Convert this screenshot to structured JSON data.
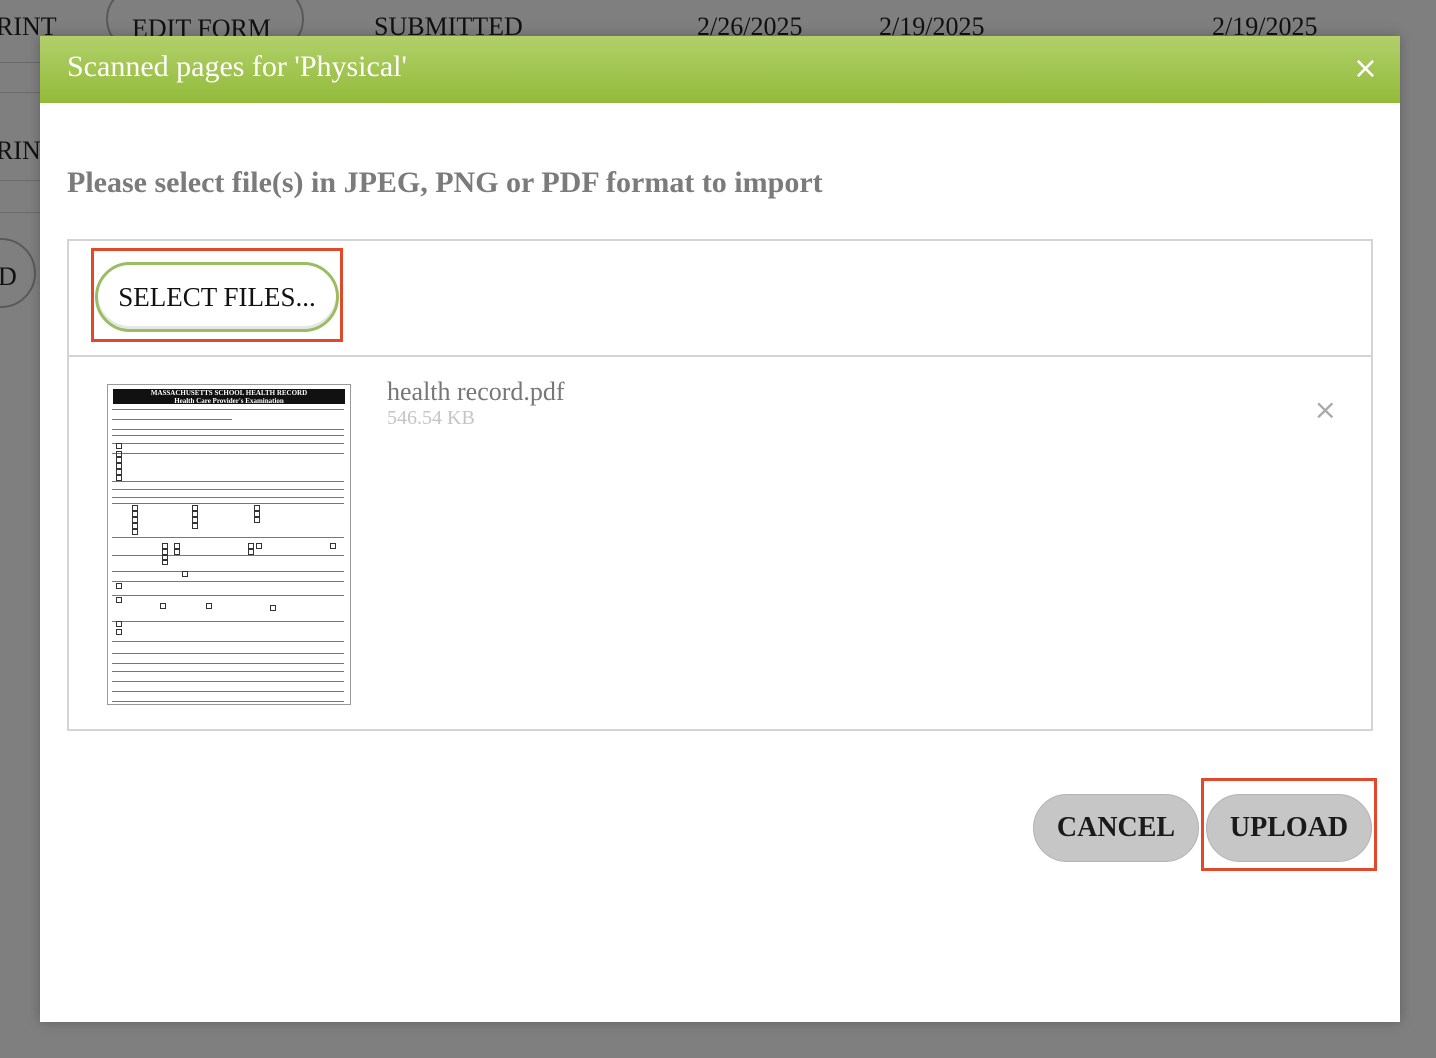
{
  "background": {
    "row1": [
      "RINT",
      "EDIT FORM",
      "SUBMITTED",
      "2/26/2025",
      "2/19/2025",
      "2/19/2025"
    ],
    "row2": [
      "RINT"
    ],
    "row3": [
      "D"
    ]
  },
  "modal": {
    "title": "Scanned pages for 'Physical'",
    "close_icon": "×",
    "instructions": "Please select file(s) in JPEG, PNG or PDF format to import",
    "select_files_label": "SELECT FILES...",
    "file": {
      "name": "health record.pdf",
      "size": "546.54 KB",
      "remove_icon": "×",
      "thumbnail": {
        "title": "MASSACHUSETTS SCHOOL HEALTH RECORD",
        "subtitle": "Health Care Provider's Examination"
      }
    },
    "cancel_label": "CANCEL",
    "upload_label": "UPLOAD"
  },
  "colors": {
    "header_green": "#9cc24a",
    "highlight_red": "#e04a2b",
    "button_gray": "#c6c6c6"
  }
}
